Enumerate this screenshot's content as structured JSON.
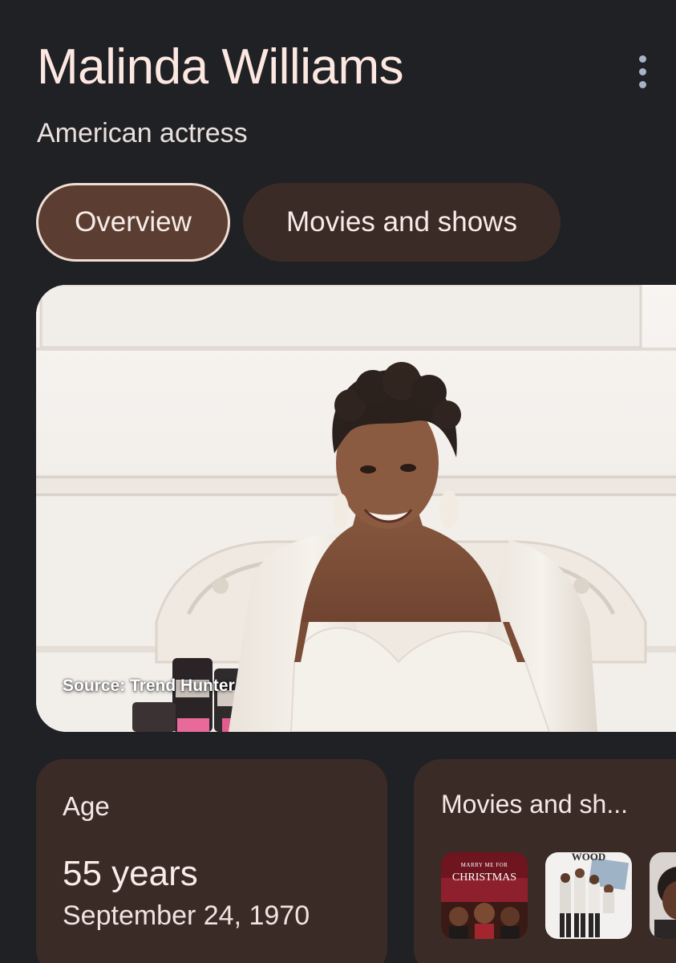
{
  "header": {
    "title": "Malinda Williams",
    "subtitle": "American actress",
    "more_icon": "more-vert-icon"
  },
  "tabs": [
    {
      "label": "Overview",
      "selected": true
    },
    {
      "label": "Movies and shows",
      "selected": false
    }
  ],
  "hero_image": {
    "source_label": "Source: Trend Hunter"
  },
  "age_card": {
    "label": "Age",
    "value": "55 years",
    "birth_date": "September 24, 1970"
  },
  "movies_card": {
    "label": "Movies and sh...",
    "posters": [
      {
        "text_top": "MARRY ME FOR",
        "text_main": "CHRISTMAS"
      },
      {
        "text_top": "WOOD"
      },
      {}
    ]
  },
  "colors": {
    "background": "#202124",
    "title": "#fde8e1",
    "chip_selected": "#5b3d31",
    "chip_unselected": "#3b2b26",
    "card": "#3b2b26"
  }
}
